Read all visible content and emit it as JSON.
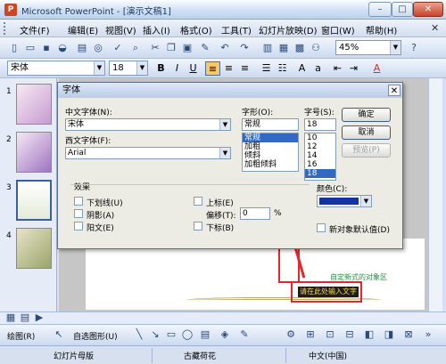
{
  "window": {
    "title": "Microsoft PowerPoint - [演示文稿1]",
    "app_letter": "P"
  },
  "menu": [
    "文件(F)",
    "编辑(E)",
    "视图(V)",
    "插入(I)",
    "格式(O)",
    "工具(T)",
    "幻灯片放映(D)",
    "窗口(W)",
    "帮助(H)"
  ],
  "toolbar": {
    "zoom": "45%"
  },
  "formatting": {
    "font": "宋体",
    "size": "18",
    "bold": "B",
    "italic": "I",
    "underline": "U",
    "shadow": "S",
    "font_color_btn": "A"
  },
  "slides": {
    "numbers": [
      "1",
      "2",
      "3",
      "4"
    ]
  },
  "dialog": {
    "title": "字体",
    "cn_font_label": "中文字体(N):",
    "cn_font_value": "宋体",
    "west_font_label": "西文字体(F):",
    "west_font_value": "Arial",
    "style_label": "字形(O):",
    "style_value": "常规",
    "style_options": [
      "常规",
      "加粗",
      "倾斜",
      "加粗倾斜"
    ],
    "size_label": "字号(S):",
    "size_value": "18",
    "size_options": [
      "10",
      "12",
      "14",
      "16",
      "18"
    ],
    "ok": "确定",
    "cancel": "取消",
    "preview": "预览(P)",
    "effects_label": "效果",
    "underline": "下划线(U)",
    "shadow": "阴影(A)",
    "emboss": "阳文(E)",
    "superscript": "上标(E)",
    "offset_label": "偏移(T):",
    "offset_value": "0",
    "offset_unit": "%",
    "subscript": "下标(B)",
    "color_label": "颜色(C):",
    "default_label": "新对象默认值(D)"
  },
  "slide": {
    "link_text": "自定新式的对象区",
    "selected_text": "请在此处输入文字"
  },
  "drawing": {
    "draw_menu": "绘图(R)",
    "autoshape": "自选图形(U)"
  },
  "status": {
    "template": "幻灯片母版",
    "design": "古藏荷花",
    "language": "中文(中国)"
  },
  "colors": {
    "accent": "#316ac5",
    "font_color": "#1133a6",
    "annotation": "#e8252a"
  }
}
